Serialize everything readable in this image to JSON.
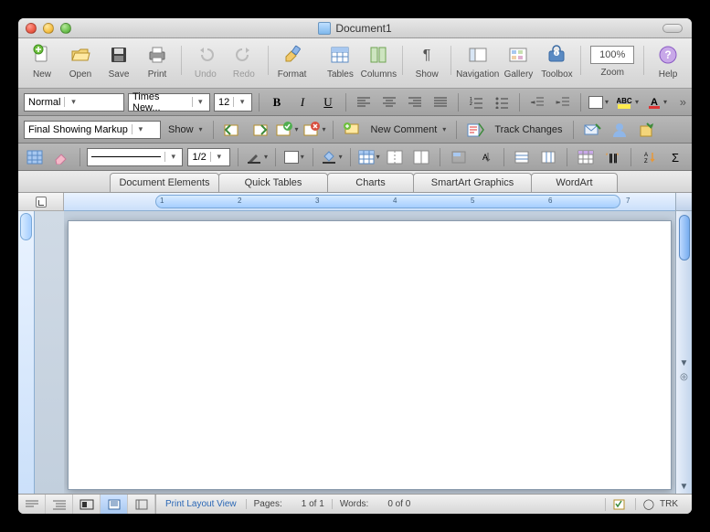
{
  "window": {
    "title": "Document1"
  },
  "toolbar_main": {
    "new": "New",
    "open": "Open",
    "save": "Save",
    "print": "Print",
    "undo": "Undo",
    "redo": "Redo",
    "format": "Format",
    "tables": "Tables",
    "columns": "Columns",
    "show": "Show",
    "navigation": "Navigation",
    "gallery": "Gallery",
    "toolbox": "Toolbox",
    "zoom": "Zoom",
    "zoom_value": "100%",
    "help": "Help"
  },
  "format_bar": {
    "style": "Normal",
    "font": "Times New...",
    "size": "12"
  },
  "review_bar": {
    "display_mode": "Final Showing Markup",
    "show_btn": "Show",
    "new_comment": "New Comment",
    "track_changes": "Track Changes"
  },
  "draw_bar": {
    "line_weight": "1/2"
  },
  "tabs": {
    "doc_elements": "Document Elements",
    "quick_tables": "Quick Tables",
    "charts": "Charts",
    "smartart": "SmartArt Graphics",
    "wordart": "WordArt"
  },
  "ruler": {
    "marks": [
      "1",
      "2",
      "3",
      "4",
      "5",
      "6",
      "7"
    ]
  },
  "status": {
    "view_name": "Print Layout View",
    "pages_label": "Pages:",
    "pages_value": "1 of 1",
    "words_label": "Words:",
    "words_value": "0 of 0",
    "trk": "TRK"
  }
}
